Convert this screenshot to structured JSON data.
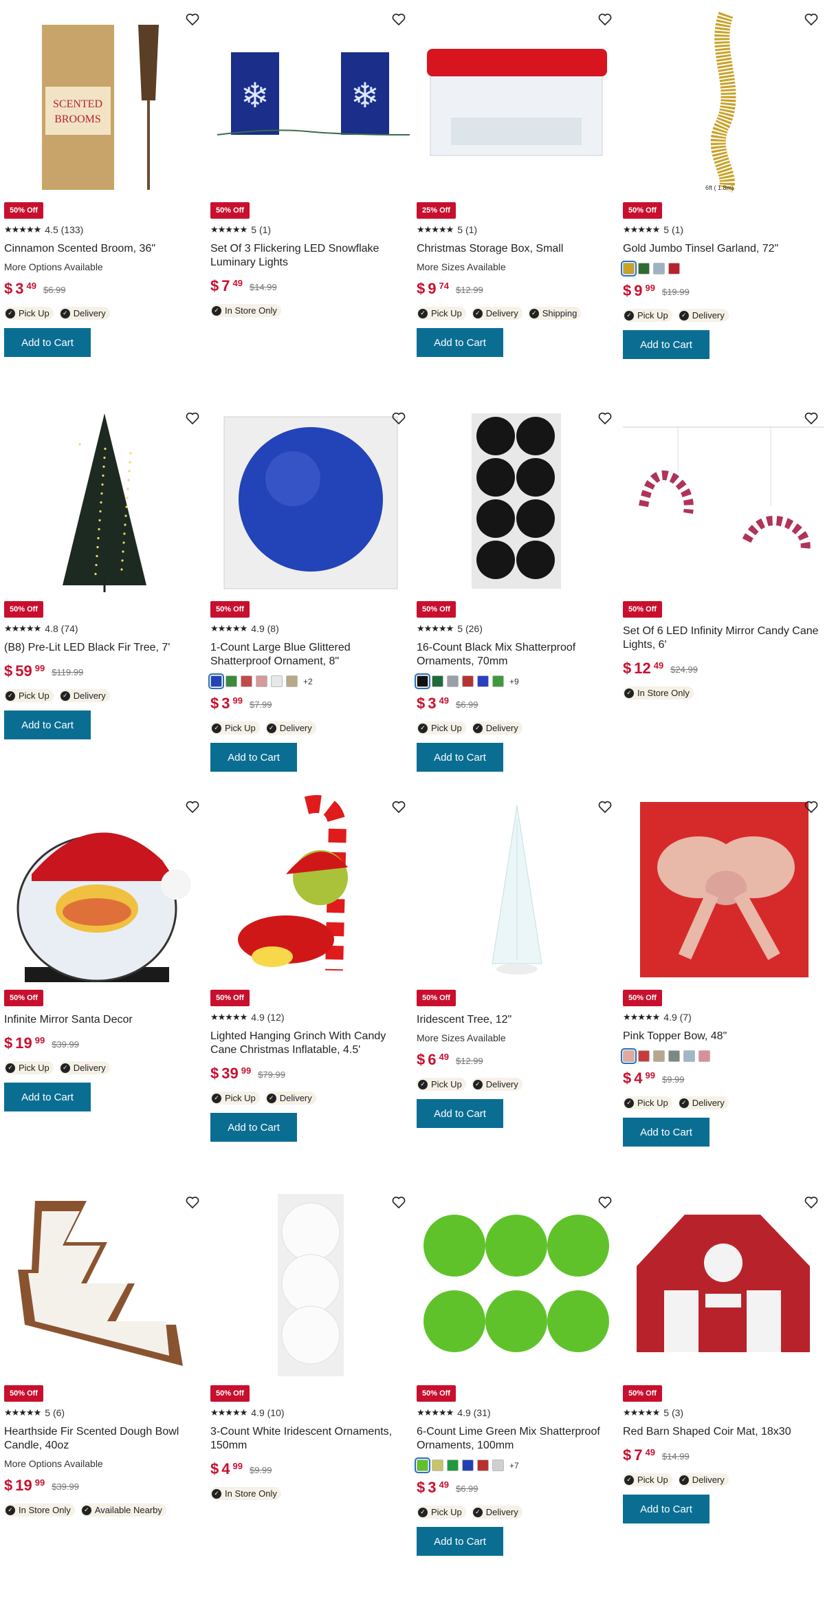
{
  "products": [
    {
      "badge": "50% Off",
      "stars": "★★★★★",
      "rating": "4.5 (133)",
      "title": "Cinnamon Scented Broom, 36\"",
      "sub": "More Options Available",
      "price_main": "3",
      "price_cents": "49",
      "was": "$6.99",
      "fulfillment": [
        "Pick Up",
        "Delivery"
      ],
      "cart": "Add to Cart",
      "icon": "broom-image"
    },
    {
      "badge": "50% Off",
      "stars": "★★★★★",
      "rating": "5 (1)",
      "title": "Set Of 3 Flickering LED Snowflake Luminary Lights",
      "sub": "",
      "price_main": "7",
      "price_cents": "49",
      "was": "$14.99",
      "fulfillment": [
        "In Store Only"
      ],
      "cart": "",
      "icon": "snowflake-luminary-image"
    },
    {
      "badge": "25% Off",
      "stars": "★★★★★",
      "rating": "5 (1)",
      "title": "Christmas Storage Box, Small",
      "sub": "More Sizes Available",
      "price_main": "9",
      "price_cents": "74",
      "was": "$12.99",
      "fulfillment": [
        "Pick Up",
        "Delivery",
        "Shipping"
      ],
      "cart": "Add to Cart",
      "icon": "storage-box-image"
    },
    {
      "badge": "50% Off",
      "stars": "★★★★★",
      "rating": "5 (1)",
      "title": "Gold Jumbo Tinsel Garland, 72\"",
      "sub": "",
      "price_main": "9",
      "price_cents": "99",
      "was": "$19.99",
      "fulfillment": [
        "Pick Up",
        "Delivery"
      ],
      "cart": "Add to Cart",
      "swatches": [
        "#c9a227",
        "#2e6b2f",
        "#9fb2c2",
        "#b8232b"
      ],
      "more": "",
      "caption": "6ft ( 1.8m)",
      "icon": "tinsel-garland-image"
    },
    {
      "badge": "50% Off",
      "stars": "★★★★★",
      "rating": "4.8 (74)",
      "title": "(B8) Pre-Lit LED Black Fir Tree, 7'",
      "sub": "",
      "price_main": "59",
      "price_cents": "99",
      "was": "$119.99",
      "fulfillment": [
        "Pick Up",
        "Delivery"
      ],
      "cart": "Add to Cart",
      "icon": "black-fir-tree-image"
    },
    {
      "badge": "50% Off",
      "stars": "★★★★★",
      "rating": "4.9 (8)",
      "title": "1-Count Large Blue Glittered Shatterproof Ornament, 8\"",
      "sub": "",
      "price_main": "3",
      "price_cents": "99",
      "was": "$7.99",
      "fulfillment": [
        "Pick Up",
        "Delivery"
      ],
      "cart": "Add to Cart",
      "swatches": [
        "#2343b8",
        "#3a8b3a",
        "#c24a4a",
        "#d79a9a",
        "#e8e8e8",
        "#b8a98a"
      ],
      "more": "+2",
      "icon": "blue-ornament-image"
    },
    {
      "badge": "50% Off",
      "stars": "★★★★★",
      "rating": "5 (26)",
      "title": "16-Count Black Mix Shatterproof Ornaments, 70mm",
      "sub": "",
      "price_main": "3",
      "price_cents": "49",
      "was": "$6.99",
      "fulfillment": [
        "Pick Up",
        "Delivery"
      ],
      "cart": "Add to Cart",
      "swatches": [
        "#111111",
        "#1f6b3a",
        "#9aa0a8",
        "#b83232",
        "#2a3fbf",
        "#3f9a3f"
      ],
      "more": "+9",
      "icon": "black-ornaments-image"
    },
    {
      "badge": "50% Off",
      "stars": "",
      "rating": "",
      "title": "Set Of 6 LED Infinity Mirror Candy Cane Lights, 6'",
      "sub": "",
      "price_main": "12",
      "price_cents": "49",
      "was": "$24.99",
      "fulfillment": [
        "In Store Only"
      ],
      "cart": "",
      "icon": "candy-cane-lights-image"
    },
    {
      "badge": "50% Off",
      "stars": "",
      "rating": "",
      "title": "Infinite Mirror Santa Decor",
      "sub": "",
      "price_main": "19",
      "price_cents": "99",
      "was": "$39.99",
      "fulfillment": [
        "Pick Up",
        "Delivery"
      ],
      "cart": "Add to Cart",
      "icon": "santa-decor-image"
    },
    {
      "badge": "50% Off",
      "stars": "★★★★★",
      "rating": "4.9 (12)",
      "title": "Lighted Hanging Grinch With Candy Cane Christmas Inflatable, 4.5'",
      "sub": "",
      "price_main": "39",
      "price_cents": "99",
      "was": "$79.99",
      "fulfillment": [
        "Pick Up",
        "Delivery"
      ],
      "cart": "Add to Cart",
      "icon": "grinch-inflatable-image"
    },
    {
      "badge": "50% Off",
      "stars": "",
      "rating": "",
      "title": "Iridescent Tree, 12\"",
      "sub": "More Sizes Available",
      "price_main": "6",
      "price_cents": "49",
      "was": "$12.99",
      "fulfillment": [
        "Pick Up",
        "Delivery"
      ],
      "cart": "Add to Cart",
      "icon": "iridescent-tree-image"
    },
    {
      "badge": "50% Off",
      "stars": "★★★★★",
      "rating": "4.9 (7)",
      "title": "Pink Topper Bow, 48\"",
      "sub": "",
      "price_main": "4",
      "price_cents": "99",
      "was": "$9.99",
      "fulfillment": [
        "Pick Up",
        "Delivery"
      ],
      "cart": "Add to Cart",
      "swatches": [
        "#e3a9a0",
        "#c83b3b",
        "#b8a78a",
        "#7a8a80",
        "#9fb7c7",
        "#d9909a"
      ],
      "more": "",
      "icon": "pink-bow-image"
    },
    {
      "badge": "50% Off",
      "stars": "★★★★★",
      "rating": "5 (6)",
      "title": "Hearthside Fir Scented Dough Bowl Candle, 40oz",
      "sub": "More Options Available",
      "price_main": "19",
      "price_cents": "99",
      "was": "$39.99",
      "fulfillment": [
        "In Store Only",
        "Available Nearby"
      ],
      "cart": "",
      "icon": "dough-bowl-candle-image"
    },
    {
      "badge": "50% Off",
      "stars": "★★★★★",
      "rating": "4.9 (10)",
      "title": "3-Count White Iridescent Ornaments, 150mm",
      "sub": "",
      "price_main": "4",
      "price_cents": "99",
      "was": "$9.99",
      "fulfillment": [
        "In Store Only"
      ],
      "cart": "",
      "icon": "white-ornaments-image"
    },
    {
      "badge": "50% Off",
      "stars": "★★★★★",
      "rating": "4.9 (31)",
      "title": "6-Count Lime Green Mix Shatterproof Ornaments, 100mm",
      "sub": "",
      "price_main": "3",
      "price_cents": "49",
      "was": "$6.99",
      "fulfillment": [
        "Pick Up",
        "Delivery"
      ],
      "cart": "Add to Cart",
      "swatches": [
        "#5fc22a",
        "#c7c46a",
        "#1f9a3f",
        "#2140b5",
        "#b82f2f",
        "#cfcfcf"
      ],
      "more": "+7",
      "icon": "lime-ornaments-image"
    },
    {
      "badge": "50% Off",
      "stars": "★★★★★",
      "rating": "5 (3)",
      "title": "Red Barn Shaped Coir Mat, 18x30",
      "sub": "",
      "price_main": "7",
      "price_cents": "49",
      "was": "$14.99",
      "fulfillment": [
        "Pick Up",
        "Delivery"
      ],
      "cart": "Add to Cart",
      "icon": "barn-mat-image"
    }
  ],
  "currency_symbol": "$"
}
